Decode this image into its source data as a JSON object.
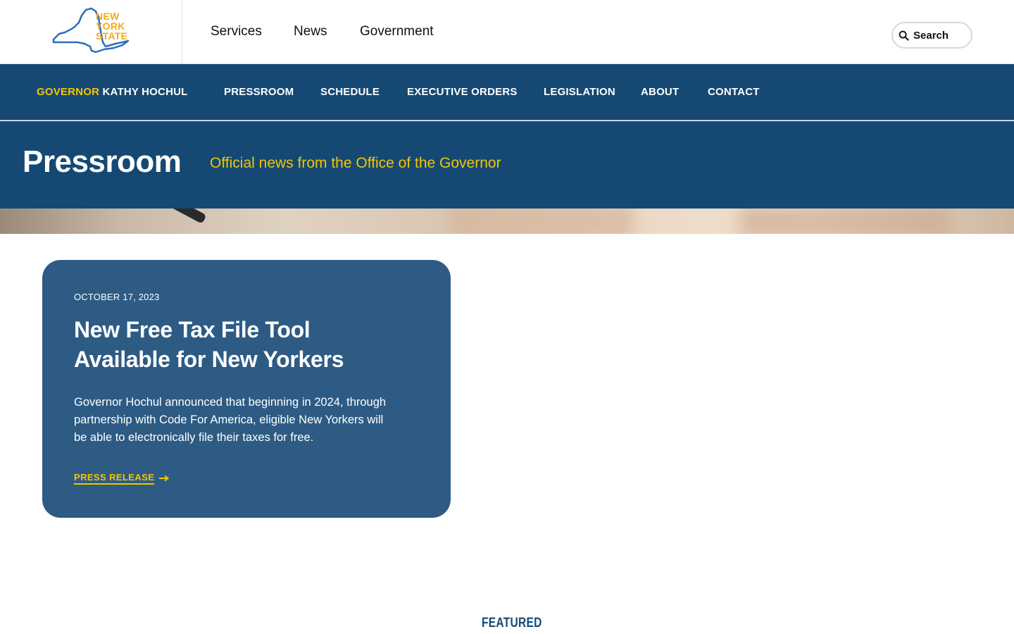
{
  "header": {
    "logo": {
      "line1": "NEW",
      "line2": "YORK",
      "line3": "STATE"
    },
    "top_nav": [
      {
        "label": "Services"
      },
      {
        "label": "News"
      },
      {
        "label": "Government"
      }
    ],
    "search_label": "Search"
  },
  "main_nav": {
    "governor_prefix": "GOVERNOR",
    "governor_name": "KATHY HOCHUL",
    "items": [
      {
        "label": "PRESSROOM"
      },
      {
        "label": "SCHEDULE"
      },
      {
        "label": "EXECUTIVE ORDERS"
      },
      {
        "label": "LEGISLATION"
      },
      {
        "label": "ABOUT"
      },
      {
        "label": "CONTACT"
      }
    ]
  },
  "banner": {
    "title": "Pressroom",
    "subtitle": "Official news from the Office of the Governor"
  },
  "card": {
    "date": "OCTOBER 17, 2023",
    "title_line1": "New Free Tax File Tool",
    "title_line2": "Available for New Yorkers",
    "body_line1": "Governor Hochul announced that beginning in 2024, through",
    "body_line2": "partnership with Code For America, eligible New Yorkers will",
    "body_line3": "be able to electronically file their taxes for free.",
    "cta_label": "PRESS RELEASE"
  },
  "featured_heading": "FEATURED",
  "colors": {
    "navy": "#154973",
    "card_blue": "#2d5b84",
    "gold": "#f4c500",
    "logo_blue": "#2a6ebb",
    "logo_gold": "#f3a91a"
  }
}
